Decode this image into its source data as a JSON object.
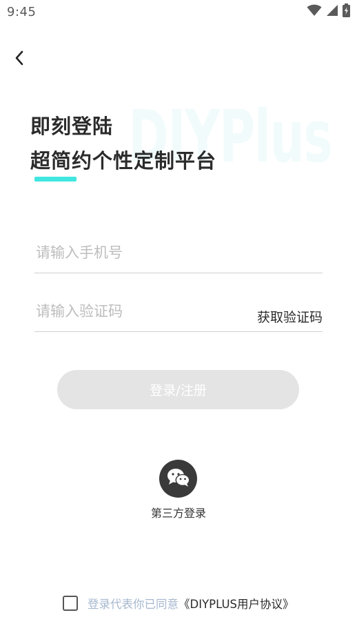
{
  "status_bar": {
    "time": "9:45",
    "icons": [
      "wifi-icon",
      "cellular-signal-icon",
      "battery-charging-icon"
    ]
  },
  "navigation": {
    "back_icon": "chevron-left-icon"
  },
  "header": {
    "watermark": "DIYPlus",
    "title_line_1": "即刻登陆",
    "title_line_2": "超简约个性定制平台"
  },
  "form": {
    "phone_placeholder": "请输入手机号",
    "phone_value": "",
    "code_placeholder": "请输入验证码",
    "code_value": "",
    "get_code_label": "获取验证码",
    "submit_label": "登录/注册"
  },
  "third_party": {
    "icon": "wechat-icon",
    "label": "第三方登录"
  },
  "agreement": {
    "checked": false,
    "text": "登录代表你已同意",
    "link": "《DIYPLUS用户协议》"
  },
  "colors": {
    "accent": "#42e6e0",
    "watermark": "#f1fbfc",
    "button_disabled": "#e4e4e4",
    "agreement_text": "#a7b8d0",
    "icon_dark": "#3a3a3a"
  }
}
